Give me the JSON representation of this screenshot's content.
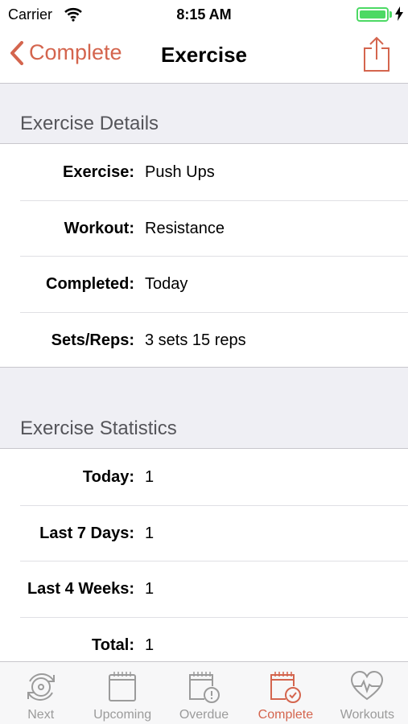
{
  "status_bar": {
    "carrier": "Carrier",
    "time": "8:15 AM"
  },
  "nav": {
    "back_label": "Complete",
    "title": "Exercise"
  },
  "sections": {
    "details_header": "Exercise Details",
    "stats_header": "Exercise Statistics"
  },
  "details": {
    "rows": [
      {
        "key": "Exercise:",
        "value": "Push Ups"
      },
      {
        "key": "Workout:",
        "value": "Resistance"
      },
      {
        "key": "Completed:",
        "value": "Today"
      },
      {
        "key": "Sets/Reps:",
        "value": "3 sets 15 reps"
      }
    ]
  },
  "stats": {
    "rows": [
      {
        "key": "Today:",
        "value": "1"
      },
      {
        "key": "Last 7 Days:",
        "value": "1"
      },
      {
        "key": "Last 4 Weeks:",
        "value": "1"
      },
      {
        "key": "Total:",
        "value": "1"
      }
    ]
  },
  "tabs": [
    {
      "label": "Next",
      "icon": "cycle-icon",
      "active": false
    },
    {
      "label": "Upcoming",
      "icon": "calendar-icon",
      "active": false
    },
    {
      "label": "Overdue",
      "icon": "calendar-alert-icon",
      "active": false
    },
    {
      "label": "Complete",
      "icon": "calendar-check-icon",
      "active": true
    },
    {
      "label": "Workouts",
      "icon": "heart-pulse-icon",
      "active": false
    }
  ],
  "colors": {
    "accent": "#d4654e",
    "inactive": "#9b9b9b",
    "battery": "#4cd964"
  }
}
